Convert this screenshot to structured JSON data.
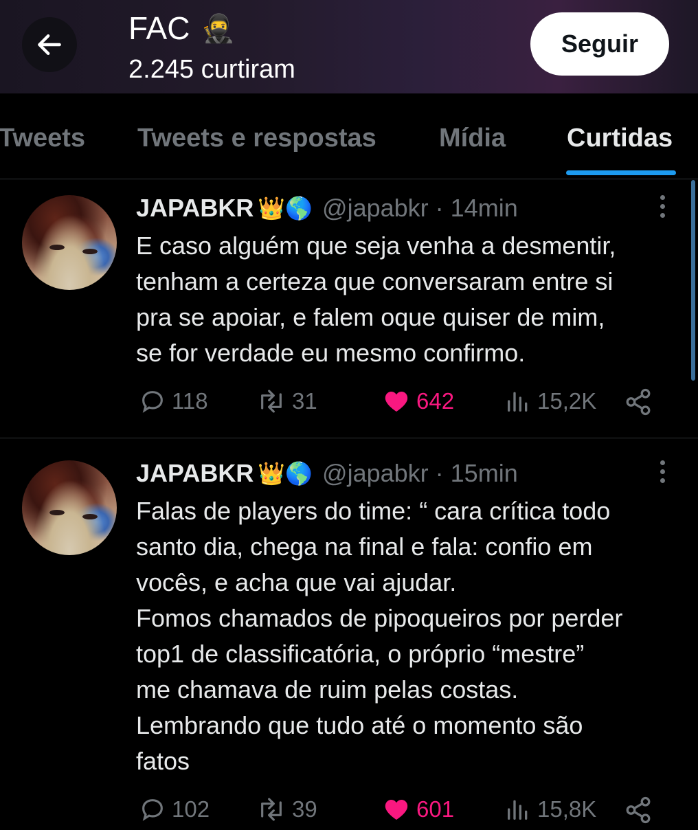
{
  "header": {
    "title": "FAC",
    "title_emoji": "🥷",
    "subtitle": "2.245 curtiram",
    "follow_label": "Seguir",
    "back_icon": "arrow-left-icon"
  },
  "tabs": [
    {
      "label": "Tweets",
      "active": false
    },
    {
      "label": "Tweets e respostas",
      "active": false
    },
    {
      "label": "Mídia",
      "active": false
    },
    {
      "label": "Curtidas",
      "active": true
    }
  ],
  "colors": {
    "accent": "#1d9bf0",
    "like": "#f91880",
    "muted": "#71767b",
    "background": "#000000"
  },
  "tweets": [
    {
      "name": "JAPABKR",
      "emojis": "👑🌎",
      "handle": "@japabkr",
      "time": "· 14min",
      "text": "E caso alguém que seja venha a desmentir,\ntenham a certeza que conversaram entre si\npra se apoiar, e falem oque quiser de mim,\nse for verdade eu mesmo confirmo.",
      "replies": "118",
      "retweets": "31",
      "likes": "642",
      "views": "15,2K"
    },
    {
      "name": "JAPABKR",
      "emojis": "👑🌎",
      "handle": "@japabkr",
      "time": "· 15min",
      "text": "Falas de players do time: “ cara crítica todo\nsanto dia, chega na final e fala: confio em\nvocês, e acha que vai ajudar.\nFomos chamados de pipoqueiros por perder\ntop1 de classificatória, o próprio “mestre”\nme chamava de ruim pelas costas.\nLembrando que tudo até o momento são\nfatos",
      "replies": "102",
      "retweets": "39",
      "likes": "601",
      "views": "15,8K"
    }
  ]
}
